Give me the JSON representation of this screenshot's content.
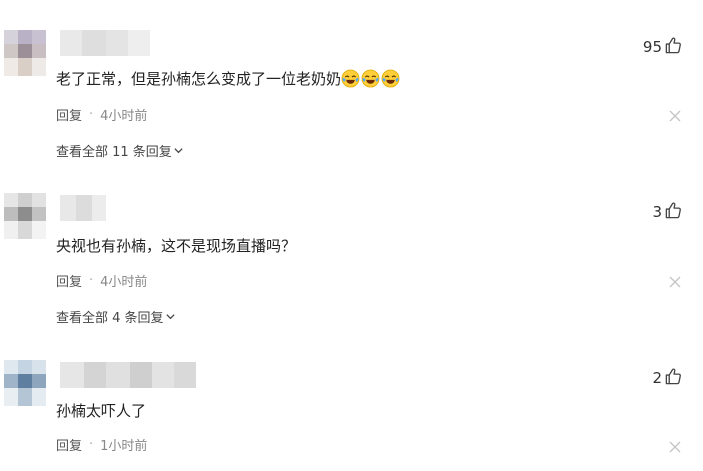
{
  "comments": [
    {
      "text": "老了正常，但是孙楠怎么变成了一位老奶奶",
      "emoji_count": 3,
      "emoji": "crying-laughing-emoji",
      "likes": "95",
      "reply_label": "回复",
      "time": "4小时前",
      "view_all": "查看全部 11 条回复"
    },
    {
      "text": "央视也有孙楠，这不是现场直播吗？",
      "likes": "3",
      "reply_label": "回复",
      "time": "4小时前",
      "view_all": "查看全部 4 条回复"
    },
    {
      "text": "孙楠太吓人了",
      "likes": "2",
      "reply_label": "回复",
      "time": "1小时前"
    }
  ],
  "separator": "·",
  "icons": {
    "like": "thumbs-up-icon",
    "close": "close-icon",
    "expand": "chevron-down-icon"
  },
  "colors": {
    "text": "#222222",
    "meta": "#888888",
    "close": "#c8c8c8"
  }
}
